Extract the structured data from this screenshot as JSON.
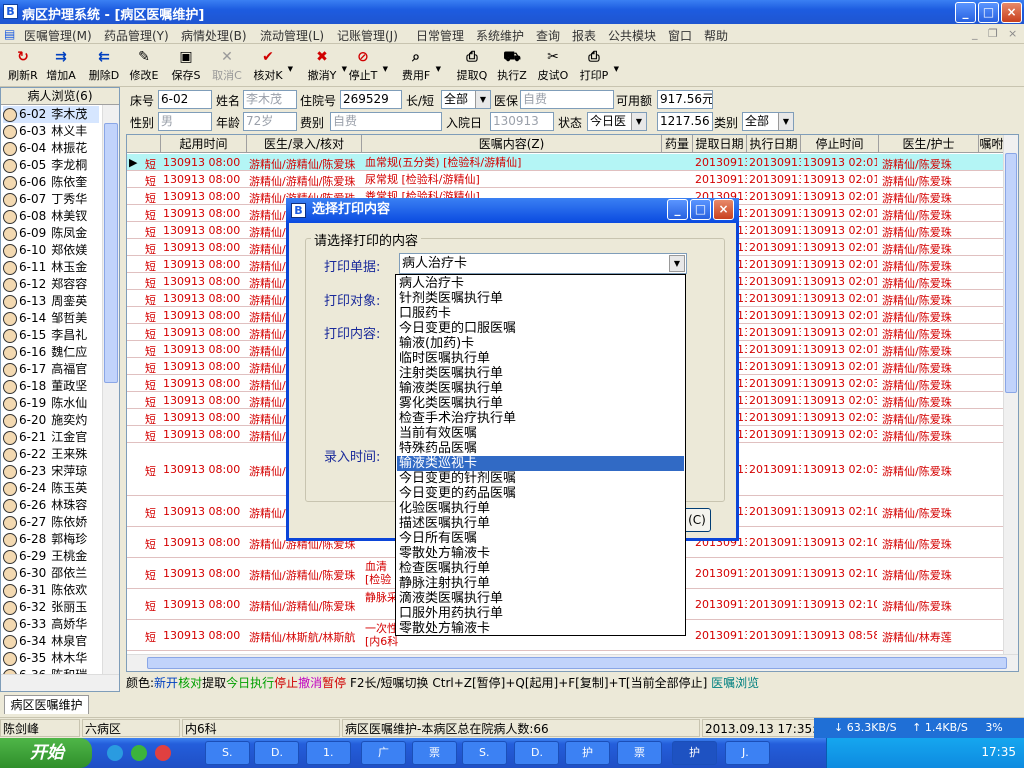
{
  "window": {
    "title": "病区护理系统 - [病区医嘱维护]",
    "btn_min": "_",
    "btn_max": "□",
    "btn_close": "×"
  },
  "menu": [
    "医嘱管理(M)",
    "药品管理(Y)",
    "病情处理(B)",
    "流动管理(L)",
    "记账管理(J)",
    "日常管理",
    "系统维护",
    "查询",
    "报表",
    "公共模块",
    "窗口",
    "帮助"
  ],
  "mdi": {
    "min": "_",
    "restore": "❐",
    "close": "×"
  },
  "toolbar": [
    {
      "label": "刷新R",
      "icon": "refresh-icon",
      "glyph": "↻",
      "color": "#d00000",
      "disabled": false
    },
    {
      "label": "增加A",
      "icon": "add-icon",
      "glyph": "⇉",
      "color": "#0040c0",
      "disabled": false
    },
    {
      "label": "删除D",
      "icon": "delete-icon",
      "glyph": "⇇",
      "color": "#0040c0",
      "disabled": false
    },
    {
      "label": "修改E",
      "icon": "edit-icon",
      "glyph": "✎",
      "color": "#000",
      "disabled": false
    },
    {
      "label": "保存S",
      "icon": "save-icon",
      "glyph": "▣",
      "color": "#000",
      "disabled": false
    },
    {
      "label": "取消C",
      "icon": "cancel-icon",
      "glyph": "✕",
      "color": "#999",
      "disabled": true
    },
    {
      "label": "核对K",
      "icon": "check-icon",
      "glyph": "✔",
      "color": "#d00000",
      "disabled": false
    },
    {
      "label": "撤消Y",
      "icon": "undo-icon",
      "glyph": "✖",
      "color": "#d00000",
      "disabled": false
    },
    {
      "label": "停止T",
      "icon": "stop-icon",
      "glyph": "⊘",
      "color": "#d00000",
      "disabled": false
    },
    {
      "label": "费用F",
      "icon": "fee-icon",
      "glyph": "⌕",
      "color": "#000",
      "disabled": false
    },
    {
      "label": "提取Q",
      "icon": "extract-icon",
      "glyph": "⎙",
      "color": "#000",
      "disabled": false
    },
    {
      "label": "执行Z",
      "icon": "execute-icon",
      "glyph": "⛟",
      "color": "#000",
      "disabled": false
    },
    {
      "label": "皮试O",
      "icon": "skintest-icon",
      "glyph": "✂",
      "color": "#000",
      "disabled": false
    },
    {
      "label": "打印P",
      "icon": "print-icon",
      "glyph": "⎙",
      "color": "#000",
      "disabled": false
    }
  ],
  "patients": {
    "header": "病人浏览(6)",
    "list": [
      [
        "6-02",
        "李木茂"
      ],
      [
        "6-03",
        "林义丰"
      ],
      [
        "6-04",
        "林振花"
      ],
      [
        "6-05",
        "李龙桐"
      ],
      [
        "6-06",
        "陈依奎"
      ],
      [
        "6-07",
        "丁秀华"
      ],
      [
        "6-08",
        "林美钗"
      ],
      [
        "6-09",
        "陈凤金"
      ],
      [
        "6-10",
        "郑依媄"
      ],
      [
        "6-11",
        "林玉金"
      ],
      [
        "6-12",
        "郑容容"
      ],
      [
        "6-13",
        "周銮英"
      ],
      [
        "6-14",
        "邹哲美"
      ],
      [
        "6-15",
        "李昌礼"
      ],
      [
        "6-16",
        "魏仁应"
      ],
      [
        "6-17",
        "高福官"
      ],
      [
        "6-18",
        "董政坚"
      ],
      [
        "6-19",
        "陈水仙"
      ],
      [
        "6-20",
        "施奕灼"
      ],
      [
        "6-21",
        "江金官"
      ],
      [
        "6-22",
        "王来殊"
      ],
      [
        "6-23",
        "宋萍琼"
      ],
      [
        "6-24",
        "陈玉英"
      ],
      [
        "6-26",
        "林珠容"
      ],
      [
        "6-27",
        "陈依娇"
      ],
      [
        "6-28",
        "郭梅珍"
      ],
      [
        "6-29",
        "王桃金"
      ],
      [
        "6-30",
        "邵依兰"
      ],
      [
        "6-31",
        "陈依欢"
      ],
      [
        "6-32",
        "张丽玉"
      ],
      [
        "6-33",
        "高娇华"
      ],
      [
        "6-34",
        "林泉官"
      ],
      [
        "6-35",
        "林木华"
      ],
      [
        "6-36",
        "陈和瑞"
      ]
    ]
  },
  "form": {
    "bed_label": "床号",
    "bed": "6-02",
    "name_label": "姓名",
    "name": "李木茂",
    "inpatient_label": "住院号",
    "inpatient": "269529",
    "type_label": "长/短",
    "type": "全部",
    "insurance_label": "医保",
    "insurance": "自费",
    "balance_label": "可用额",
    "balance": "917.56元",
    "gender_label": "性别",
    "gender": "男",
    "age_label": "年龄",
    "age": "72岁",
    "fee_label": "费别",
    "fee": "自费",
    "admit_label": "入院日",
    "admit": "130913",
    "status_label": "状态",
    "status": "今日医",
    "amount": "1217.56",
    "category_label": "类别",
    "category": "全部"
  },
  "grid": {
    "headers": [
      "起用时间",
      "医生/录入/核对",
      "医嘱内容(Z)",
      "药量",
      "提取日期",
      "执行日期",
      "停止时间",
      "医生/护士",
      "嘱咐"
    ],
    "rows": [
      {
        "t": "短",
        "start": "130913 08:00",
        "doc": "游精仙/游精仙/陈爱珠",
        "content": "血常规(五分类)  [检验科/游精仙]",
        "extract": "20130913",
        "exec": "20130913",
        "stop": "130913 02:01",
        "nurse": "游精仙/陈爱珠"
      },
      {
        "t": "短",
        "start": "130913 08:00",
        "doc": "游精仙/游精仙/陈爱珠",
        "content": "尿常规  [检验科/游精仙]",
        "extract": "20130913",
        "exec": "20130913",
        "stop": "130913 02:01",
        "nurse": "游精仙/陈爱珠"
      },
      {
        "t": "短",
        "start": "130913 08:00",
        "doc": "游精仙/游精仙/陈爱珠",
        "content": "粪常规  [检验科/游精仙]",
        "extract": "20130913",
        "exec": "20130913",
        "stop": "130913 02:01",
        "nurse": "游精仙/陈爱珠"
      },
      {
        "t": "短",
        "start": "130913 08:00",
        "doc": "游精仙/游精仙/陈爱珠",
        "content": "",
        "extract": "20130913",
        "exec": "20130913",
        "stop": "130913 02:01",
        "nurse": "游精仙/陈爱珠"
      },
      {
        "t": "短",
        "start": "130913 08:00",
        "doc": "游精仙/游精仙/陈爱珠",
        "content": "",
        "extract": "20130913",
        "exec": "20130913",
        "stop": "130913 02:01",
        "nurse": "游精仙/陈爱珠"
      },
      {
        "t": "短",
        "start": "130913 08:00",
        "doc": "游精仙/游精仙/陈爱珠",
        "content": "",
        "extract": "20130913",
        "exec": "20130913",
        "stop": "130913 02:01",
        "nurse": "游精仙/陈爱珠"
      },
      {
        "t": "短",
        "start": "130913 08:00",
        "doc": "游精仙/游精仙/陈爱珠",
        "content": "",
        "extract": "20130913",
        "exec": "20130913",
        "stop": "130913 02:01",
        "nurse": "游精仙/陈爱珠"
      },
      {
        "t": "短",
        "start": "130913 08:00",
        "doc": "游精仙/游精仙/陈爱珠",
        "content": "",
        "extract": "20130913",
        "exec": "20130913",
        "stop": "130913 02:01",
        "nurse": "游精仙/陈爱珠"
      },
      {
        "t": "短",
        "start": "130913 08:00",
        "doc": "游精仙/游精仙/陈爱珠",
        "content": "",
        "extract": "20130913",
        "exec": "20130913",
        "stop": "130913 02:01",
        "nurse": "游精仙/陈爱珠"
      },
      {
        "t": "短",
        "start": "130913 08:00",
        "doc": "游精仙/游精仙/陈爱珠",
        "content": "",
        "extract": "20130913",
        "exec": "20130913",
        "stop": "130913 02:01",
        "nurse": "游精仙/陈爱珠"
      },
      {
        "t": "短",
        "start": "130913 08:00",
        "doc": "游精仙/游精仙/陈爱珠",
        "content": "",
        "extract": "20130913",
        "exec": "20130913",
        "stop": "130913 02:01",
        "nurse": "游精仙/陈爱珠"
      },
      {
        "t": "短",
        "start": "130913 08:00",
        "doc": "游精仙/游精仙/陈爱珠",
        "content": "",
        "extract": "20130913",
        "exec": "20130913",
        "stop": "130913 02:01",
        "nurse": "游精仙/陈爱珠"
      },
      {
        "t": "短",
        "start": "130913 08:00",
        "doc": "游精仙/游精仙/陈爱珠",
        "content": "",
        "extract": "20130913",
        "exec": "20130913",
        "stop": "130913 02:01",
        "nurse": "游精仙/陈爱珠"
      },
      {
        "t": "短",
        "start": "130913 08:00",
        "doc": "游精仙/游精仙/陈爱珠",
        "content": "",
        "extract": "20130913",
        "exec": "20130913",
        "stop": "130913 02:03",
        "nurse": "游精仙/陈爱珠"
      },
      {
        "t": "短",
        "start": "130913 08:00",
        "doc": "游精仙/游精仙/陈爱珠",
        "content": "",
        "extract": "20130913",
        "exec": "20130913",
        "stop": "130913 02:03",
        "nurse": "游精仙/陈爱珠"
      },
      {
        "t": "短",
        "start": "130913 08:00",
        "doc": "游精仙/游精仙/陈爱珠",
        "content": "",
        "extract": "20130913",
        "exec": "20130913",
        "stop": "130913 02:03",
        "nurse": "游精仙/陈爱珠"
      },
      {
        "t": "短",
        "start": "130913 08:00",
        "doc": "游精仙/游精仙/陈爱珠",
        "content": "",
        "extract": "20130913",
        "exec": "20130913",
        "stop": "130913 02:03",
        "nurse": "游精仙/陈爱珠"
      },
      {
        "t": "短",
        "start": "130913 08:00",
        "doc": "游精仙/游精仙/陈爱珠",
        "content": "",
        "extract": "20130913",
        "exec": "20130913",
        "stop": "130913 02:03",
        "nurse": "游精仙/陈爱珠"
      },
      {
        "t": "短",
        "start": "130913 08:00",
        "doc": "游精仙/游精仙/陈爱珠",
        "content": "",
        "extract": "20130913",
        "exec": "20130913",
        "stop": "130913 02:10",
        "nurse": "游精仙/陈爱珠"
      },
      {
        "t": "短",
        "start": "130913 08:00",
        "doc": "游精仙/游精仙/陈爱珠",
        "content": "[检验",
        "extract": "20130913",
        "exec": "20130913",
        "stop": "130913 02:10",
        "nurse": "游精仙/陈爱珠"
      },
      {
        "t": "短",
        "start": "130913 08:00",
        "doc": "游精仙/游精仙/陈爱珠",
        "content": "血清\n[检验",
        "extract": "20130913",
        "exec": "20130913",
        "stop": "130913 02:10",
        "nurse": "游精仙/陈爱珠"
      },
      {
        "t": "短",
        "start": "130913 08:00",
        "doc": "游精仙/游精仙/陈爱珠",
        "content": "静脉采",
        "extract": "20130913",
        "exec": "20130913",
        "stop": "130913 02:10",
        "nurse": "游精仙/陈爱珠"
      },
      {
        "t": "短",
        "start": "130913 08:00",
        "doc": "游精仙/林斯航/林斯航",
        "content": "一次性\n[内6科",
        "extract": "20130913",
        "exec": "20130913",
        "stop": "130913 08:58",
        "nurse": "游精仙/林寿莲"
      },
      {
        "t": "",
        "start": "",
        "doc": "",
        "content": "0.9%氯化钠注射液(生理盐水)[250ml(软袋)┓ 静脉输",
        "extract": "",
        "exec": "",
        "stop": "",
        "nurse": ""
      }
    ]
  },
  "legend": [
    {
      "text": "颜色:",
      "color": "#000000"
    },
    {
      "text": "新开",
      "color": "#0040c0"
    },
    {
      "text": "核对",
      "color": "#00a000"
    },
    {
      "text": "提取",
      "color": "#000000"
    },
    {
      "text": "今日执行",
      "color": "#00a000"
    },
    {
      "text": "停止",
      "color": "#d00000"
    },
    {
      "text": "撤消",
      "color": "#c000c0"
    },
    {
      "text": "暂停",
      "color": "#d00000"
    },
    {
      "text": "   F2长/短嘱切换  Ctrl+Z[暂停]+Q[起用]+F[复制]+T[当前全部停止] ",
      "color": "#000000"
    },
    {
      "text": "医嘱浏览",
      "color": "#008080"
    }
  ],
  "tab": "病区医嘱维护",
  "status": {
    "user": "陈剑峰",
    "ward": "六病区",
    "dept": "内6科",
    "msg": "病区医嘱维护-本病区总在院病人数:66",
    "time": "2013.09.13 17:35:22",
    "down": "↓ 63.3KB/S",
    "up": "↑ 1.4KB/S",
    "pct": "3%"
  },
  "taskbar": {
    "start": "开始",
    "clock": "17:35",
    "buttons": [
      "S.",
      "D.",
      "1.",
      "广",
      "票",
      "S.",
      "D.",
      "护",
      "票",
      "护",
      "J."
    ]
  },
  "dialog": {
    "title": "选择打印内容",
    "group": "请选择打印的内容",
    "label_doc": "打印单据:",
    "label_target": "打印对象:",
    "label_content": "打印内容:",
    "label_time": "录入时间:",
    "selected": "病人治疗卡",
    "btn_c": "(C)",
    "options": [
      "病人治疗卡",
      "针剂类医嘱执行单",
      "口服药卡",
      "今日变更的口服医嘱",
      "输液(加药)卡",
      "临时医嘱执行单",
      "注射类医嘱执行单",
      "输液类医嘱执行单",
      "雾化类医嘱执行单",
      "检查手术治疗执行单",
      "当前有效医嘱",
      "特殊药品医嘱",
      "输液类巡视卡",
      "今日变更的针剂医嘱",
      "今日变更的药品医嘱",
      "化验医嘱执行单",
      "描述医嘱执行单",
      "今日所有医嘱",
      "零散处方输液卡",
      "检查医嘱执行单",
      "静脉注射执行单",
      "滴液类医嘱执行单",
      "口服外用药执行单",
      "零散处方输液卡"
    ],
    "highlight_index": 12
  },
  "colors": {
    "accent": "#316ac5",
    "order_red": "#d40000",
    "current_row": "#b4f5f5"
  }
}
